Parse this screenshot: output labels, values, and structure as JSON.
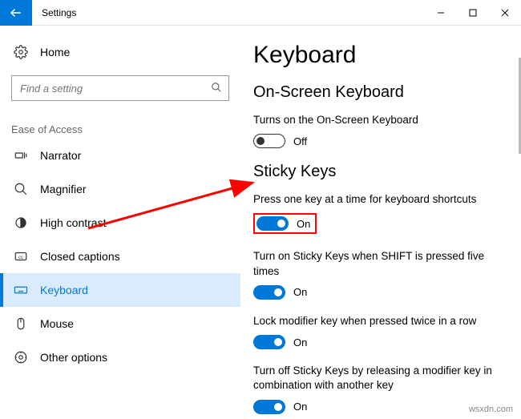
{
  "window": {
    "title": "Settings"
  },
  "sidebar": {
    "home": "Home",
    "search_placeholder": "Find a setting",
    "section": "Ease of Access",
    "items": [
      {
        "label": "Narrator"
      },
      {
        "label": "Magnifier"
      },
      {
        "label": "High contrast"
      },
      {
        "label": "Closed captions"
      },
      {
        "label": "Keyboard"
      },
      {
        "label": "Mouse"
      },
      {
        "label": "Other options"
      }
    ]
  },
  "main": {
    "heading": "Keyboard",
    "sections": [
      {
        "title": "On-Screen Keyboard",
        "settings": [
          {
            "label": "Turns on the On-Screen Keyboard",
            "state": "Off",
            "on": false
          }
        ]
      },
      {
        "title": "Sticky Keys",
        "settings": [
          {
            "label": "Press one key at a time for keyboard shortcuts",
            "state": "On",
            "on": true,
            "highlight": true
          },
          {
            "label": "Turn on Sticky Keys when SHIFT is pressed five times",
            "state": "On",
            "on": true
          },
          {
            "label": "Lock modifier key when pressed twice in a row",
            "state": "On",
            "on": true
          },
          {
            "label": "Turn off Sticky Keys by releasing a modifier key in combination with another key",
            "state": "On",
            "on": true
          }
        ]
      }
    ]
  },
  "watermark": "wsxdn.com"
}
